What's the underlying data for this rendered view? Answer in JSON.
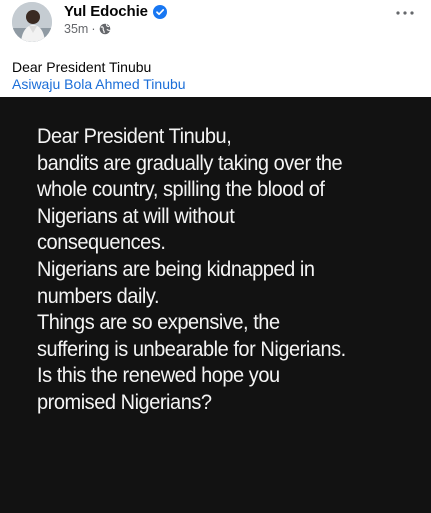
{
  "post": {
    "author": "Yul Edochie",
    "time": "35m",
    "separator": "·",
    "caption": "Dear President Tinubu",
    "tag": "Asiwaju Bola Ahmed Tinubu",
    "more_label": "···"
  },
  "image": {
    "background": "#121212",
    "lines": [
      "Dear President Tinubu,",
      "bandits are gradually taking over the",
      "whole country, spilling the blood of",
      "Nigerians at will without",
      "consequences.",
      "Nigerians are being kidnapped in",
      "numbers daily.",
      "Things are so expensive, the",
      "suffering is unbearable for Nigerians.",
      "Is this the renewed hope you",
      "promised Nigerians?"
    ]
  },
  "icons": {
    "verified": "verified-badge-icon",
    "globe": "globe-icon",
    "more": "more-options-icon"
  },
  "colors": {
    "verified": "#1877f2",
    "link": "#1b6ed8",
    "meta": "#65676b"
  }
}
